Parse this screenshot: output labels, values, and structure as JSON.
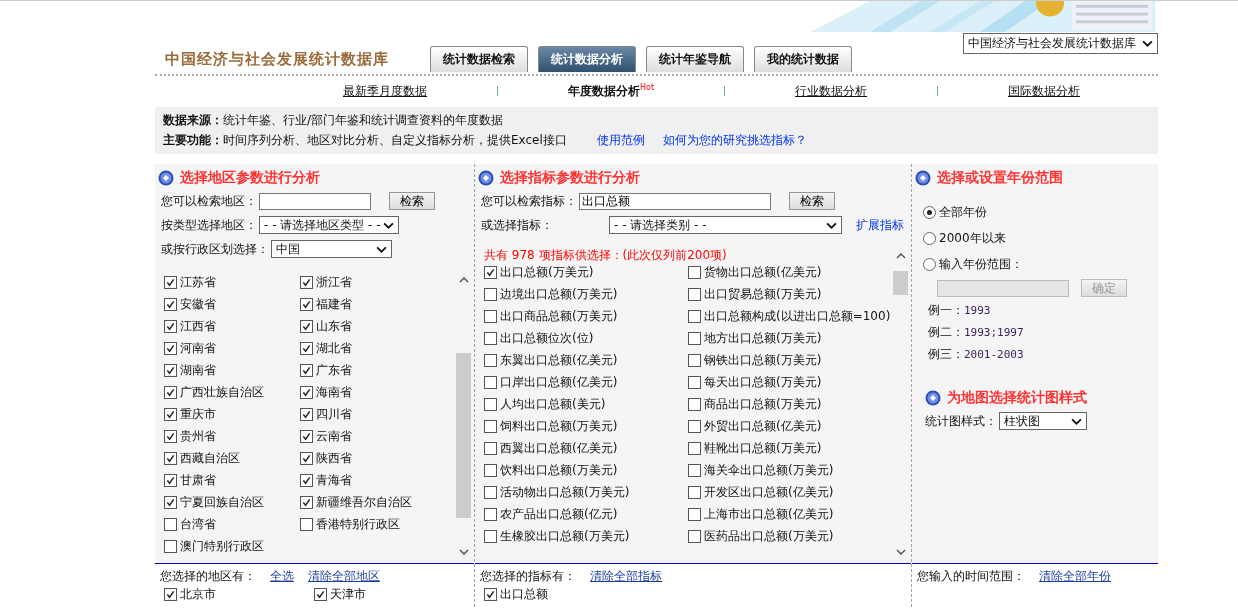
{
  "site_title": "中国经济与社会发展统计数据库",
  "main_tabs": [
    {
      "label": "统计数据检索",
      "selected": false
    },
    {
      "label": "统计数据分析",
      "selected": true
    },
    {
      "label": "统计年鉴导航",
      "selected": false
    },
    {
      "label": "我的统计数据",
      "selected": false
    }
  ],
  "database_select": {
    "value": "中国经济与社会发展统计数据库"
  },
  "sub_nav": [
    {
      "label": "最新季月度数据",
      "selected": false
    },
    {
      "label": "年度数据分析",
      "selected": true,
      "badge": "Hot"
    },
    {
      "label": "行业数据分析",
      "selected": false
    },
    {
      "label": "国际数据分析",
      "selected": false
    }
  ],
  "info": {
    "source_label": "数据来源：",
    "source_text": "统计年鉴、行业/部门年鉴和统计调查资料的年度数据",
    "function_label": "主要功能：",
    "function_text": "时间序列分析、地区对比分析、自定义指标分析，提供Excel接口",
    "links": [
      "使用范例",
      "如何为您的研究挑选指标？"
    ]
  },
  "region_panel": {
    "title": "选择地区参数进行分析",
    "search_label": "您可以检索地区：",
    "search_button": "检索",
    "type_label": "按类型选择地区：",
    "type_select": "- - 请选择地区类型 - -",
    "admin_label": "或按行政区划选择：",
    "admin_select": "中国",
    "regions": [
      {
        "label": "江苏省",
        "checked": true
      },
      {
        "label": "浙江省",
        "checked": true
      },
      {
        "label": "安徽省",
        "checked": true
      },
      {
        "label": "福建省",
        "checked": true
      },
      {
        "label": "江西省",
        "checked": true
      },
      {
        "label": "山东省",
        "checked": true
      },
      {
        "label": "河南省",
        "checked": true
      },
      {
        "label": "湖北省",
        "checked": true
      },
      {
        "label": "湖南省",
        "checked": true
      },
      {
        "label": "广东省",
        "checked": true
      },
      {
        "label": "广西壮族自治区",
        "checked": true
      },
      {
        "label": "海南省",
        "checked": true
      },
      {
        "label": "重庆市",
        "checked": true
      },
      {
        "label": "四川省",
        "checked": true
      },
      {
        "label": "贵州省",
        "checked": true
      },
      {
        "label": "云南省",
        "checked": true
      },
      {
        "label": "西藏自治区",
        "checked": true
      },
      {
        "label": "陕西省",
        "checked": true
      },
      {
        "label": "甘肃省",
        "checked": true
      },
      {
        "label": "青海省",
        "checked": true
      },
      {
        "label": "宁夏回族自治区",
        "checked": true
      },
      {
        "label": "新疆维吾尔自治区",
        "checked": true
      },
      {
        "label": "台湾省",
        "checked": false
      },
      {
        "label": "香港特别行政区",
        "checked": false
      },
      {
        "label": "澳门特别行政区",
        "checked": false
      }
    ],
    "selected_label": "您选择的地区有：",
    "select_all": "全选",
    "clear_all": "清除全部地区",
    "selected": [
      {
        "label": "北京市",
        "checked": true
      },
      {
        "label": "天津市",
        "checked": true
      }
    ]
  },
  "indicator_panel": {
    "title": "选择指标参数进行分析",
    "search_label": "您可以检索指标：",
    "search_value": "出口总额",
    "search_button": "检索",
    "category_label": "或选择指标：",
    "category_select": "- - 请选择类别 - -",
    "expand_link": "扩展指标",
    "count_text": "共有  978  项指标供选择：(此次仅列前200项)",
    "indicators": [
      {
        "label": "出口总额(万美元)",
        "checked": true
      },
      {
        "label": "货物出口总额(亿美元)",
        "checked": false
      },
      {
        "label": "边境出口总额(万美元)",
        "checked": false
      },
      {
        "label": "出口贸易总额(万美元)",
        "checked": false
      },
      {
        "label": "出口商品总额(万美元)",
        "checked": false
      },
      {
        "label": "出口总额构成(以进出口总额=100)",
        "checked": false
      },
      {
        "label": "出口总额位次(位)",
        "checked": false
      },
      {
        "label": "地方出口总额(万美元)",
        "checked": false
      },
      {
        "label": "东翼出口总额(亿美元)",
        "checked": false
      },
      {
        "label": "钢铁出口总额(万美元)",
        "checked": false
      },
      {
        "label": "口岸出口总额(亿美元)",
        "checked": false
      },
      {
        "label": "每天出口总额(万美元)",
        "checked": false
      },
      {
        "label": "人均出口总额(美元)",
        "checked": false
      },
      {
        "label": "商品出口总额(万美元)",
        "checked": false
      },
      {
        "label": "饲料出口总额(万美元)",
        "checked": false
      },
      {
        "label": "外贸出口总额(亿美元)",
        "checked": false
      },
      {
        "label": "西翼出口总额(亿美元)",
        "checked": false
      },
      {
        "label": "鞋靴出口总额(万美元)",
        "checked": false
      },
      {
        "label": "饮料出口总额(万美元)",
        "checked": false
      },
      {
        "label": "海关伞出口总额(万美元)",
        "checked": false
      },
      {
        "label": "活动物出口总额(万美元)",
        "checked": false
      },
      {
        "label": "开发区出口总额(亿美元)",
        "checked": false
      },
      {
        "label": "农产品出口总额(亿元)",
        "checked": false
      },
      {
        "label": "上海市出口总额(亿美元)",
        "checked": false
      },
      {
        "label": "生橡胶出口总额(万美元)",
        "checked": false
      },
      {
        "label": "医药品出口总额(万美元)",
        "checked": false
      }
    ],
    "selected_label": "您选择的指标有：",
    "clear_all": "清除全部指标",
    "selected": [
      {
        "label": "出口总额",
        "checked": true
      }
    ]
  },
  "year_panel": {
    "title": "选择或设置年份范围",
    "options": [
      {
        "label": "全部年份",
        "selected": true
      },
      {
        "label": "2000年以来",
        "selected": false
      },
      {
        "label": "输入年份范围：",
        "selected": false
      }
    ],
    "confirm_button": "确定",
    "examples": [
      {
        "label": "例一：",
        "value": "1993"
      },
      {
        "label": "例二：",
        "value": "1993;1997"
      },
      {
        "label": "例三：",
        "value": "2001-2003"
      }
    ],
    "chart_title": "为地图选择统计图样式",
    "chart_style_label": "统计图样式：",
    "chart_style_select": "柱状图",
    "selected_label": "您输入的时间范围：",
    "clear_all": "清除全部年份"
  }
}
